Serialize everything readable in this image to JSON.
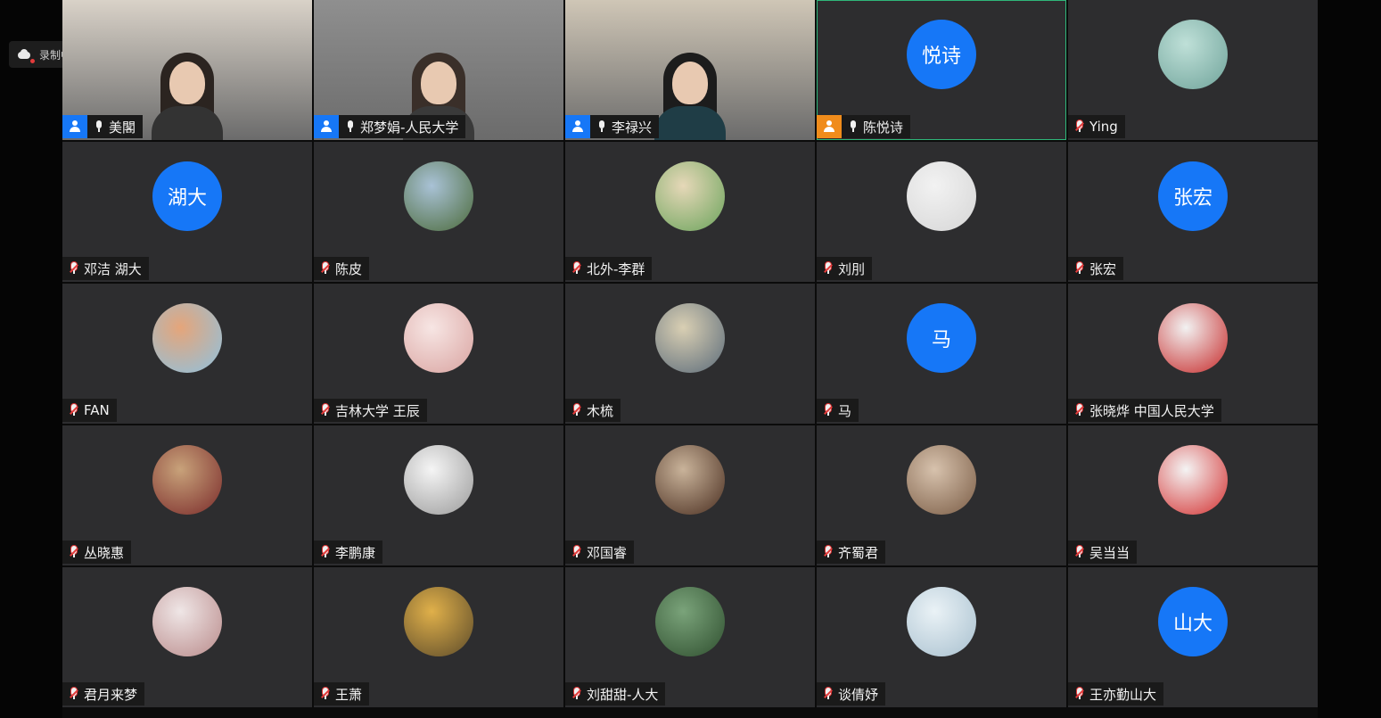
{
  "recording": {
    "label": "录制中"
  },
  "participants": [
    {
      "name": "美閣",
      "type": "video",
      "host": true,
      "host_color": "blue",
      "bg": "#d9d2c8",
      "hair": "#2b2420",
      "body": "#333",
      "muted": false
    },
    {
      "name": "郑梦娟-人民大学",
      "type": "video",
      "host": true,
      "host_color": "blue",
      "bg": "#8f8f8f",
      "hair": "#3a2f29",
      "body": "#3a3a3a",
      "muted": false
    },
    {
      "name": "李禄兴",
      "type": "video",
      "host": true,
      "host_color": "blue",
      "bg": "#cfc6b6",
      "hair": "#1c1c1c",
      "body": "#1f3d46",
      "muted": false
    },
    {
      "name": "陈悦诗",
      "type": "text",
      "avatar_text": "悦诗",
      "host": true,
      "host_color": "orange",
      "muted": false,
      "active": true
    },
    {
      "name": "Ying",
      "type": "image",
      "colors": [
        "#bfe0d8",
        "#6fa39a"
      ],
      "muted": true
    },
    {
      "name": "邓洁 湖大",
      "type": "text",
      "avatar_text": "湖大",
      "muted": true
    },
    {
      "name": "陈皮",
      "type": "image",
      "colors": [
        "#a9c2d6",
        "#4b6a3a"
      ],
      "muted": true
    },
    {
      "name": "北外-李群",
      "type": "image",
      "colors": [
        "#e6d8b8",
        "#6aa35b"
      ],
      "muted": true
    },
    {
      "name": "刘刖",
      "type": "image",
      "colors": [
        "#f2f2f2",
        "#d6d6d6"
      ],
      "muted": true
    },
    {
      "name": "张宏",
      "type": "text",
      "avatar_text": "张宏",
      "muted": true
    },
    {
      "name": "FAN",
      "type": "image",
      "colors": [
        "#e5a57a",
        "#8ec2e0"
      ],
      "muted": true
    },
    {
      "name": "吉林大学 王辰",
      "type": "image",
      "colors": [
        "#f7e6e4",
        "#d9a3a0"
      ],
      "muted": true
    },
    {
      "name": "木梳",
      "type": "image",
      "colors": [
        "#d9cfb3",
        "#5b6b7a"
      ],
      "muted": true
    },
    {
      "name": "马",
      "type": "text",
      "avatar_text": "马",
      "muted": true
    },
    {
      "name": "张晓烨 中国人民大学",
      "type": "image",
      "colors": [
        "#f2f2f2",
        "#c62828"
      ],
      "muted": true
    },
    {
      "name": "丛晓惠",
      "type": "image",
      "colors": [
        "#c8a27a",
        "#7a2a2a"
      ],
      "muted": true
    },
    {
      "name": "李鹏康",
      "type": "image",
      "colors": [
        "#f5f5f5",
        "#9a9a9a"
      ],
      "muted": true
    },
    {
      "name": "邓国睿",
      "type": "image",
      "colors": [
        "#c9b39a",
        "#4a2e20"
      ],
      "muted": true
    },
    {
      "name": "齐蜀君",
      "type": "image",
      "colors": [
        "#d7c2ad",
        "#7a5c45"
      ],
      "muted": true
    },
    {
      "name": "吴当当",
      "type": "image",
      "colors": [
        "#f4f4f4",
        "#d32f2f"
      ],
      "muted": true
    },
    {
      "name": "君月来梦",
      "type": "image",
      "colors": [
        "#efe6e6",
        "#b98a8a"
      ],
      "muted": true
    },
    {
      "name": "王萧",
      "type": "image",
      "colors": [
        "#e0b04a",
        "#5b4a2a"
      ],
      "muted": true
    },
    {
      "name": "刘甜甜-人大",
      "type": "image",
      "colors": [
        "#7aa37a",
        "#2f4f2f"
      ],
      "muted": true
    },
    {
      "name": "谈倩妤",
      "type": "image",
      "colors": [
        "#eaf2f6",
        "#a8c0cf"
      ],
      "muted": true
    },
    {
      "name": "王亦勤山大",
      "type": "text",
      "avatar_text": "山大",
      "muted": true
    }
  ]
}
